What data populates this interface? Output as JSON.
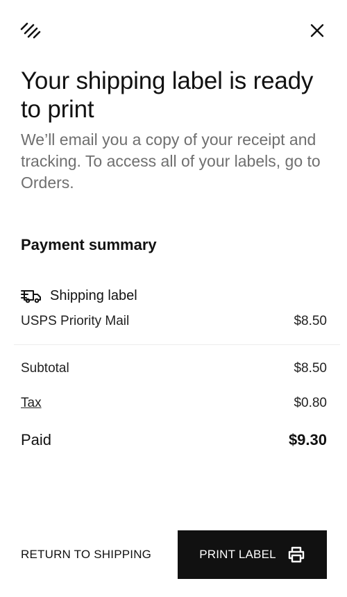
{
  "header": {
    "logo_icon": "squarespace-logo-icon",
    "close_icon": "close-icon"
  },
  "main": {
    "title": "Your shipping label is ready to print",
    "subtitle": "We’ll email you a copy of your receipt and tracking. To access all of your labels, go to Orders."
  },
  "payment_summary": {
    "heading": "Payment summary",
    "item": {
      "icon": "shipping-truck-icon",
      "label": "Shipping label",
      "service": "USPS Priority Mail",
      "price": "$8.50"
    },
    "subtotal_label": "Subtotal",
    "subtotal_value": "$8.50",
    "tax_label": "Tax",
    "tax_value": "$0.80",
    "paid_label": "Paid",
    "paid_value": "$9.30"
  },
  "footer": {
    "return_label": "RETURN TO SHIPPING",
    "print_label": "PRINT LABEL",
    "print_icon": "printer-icon"
  }
}
